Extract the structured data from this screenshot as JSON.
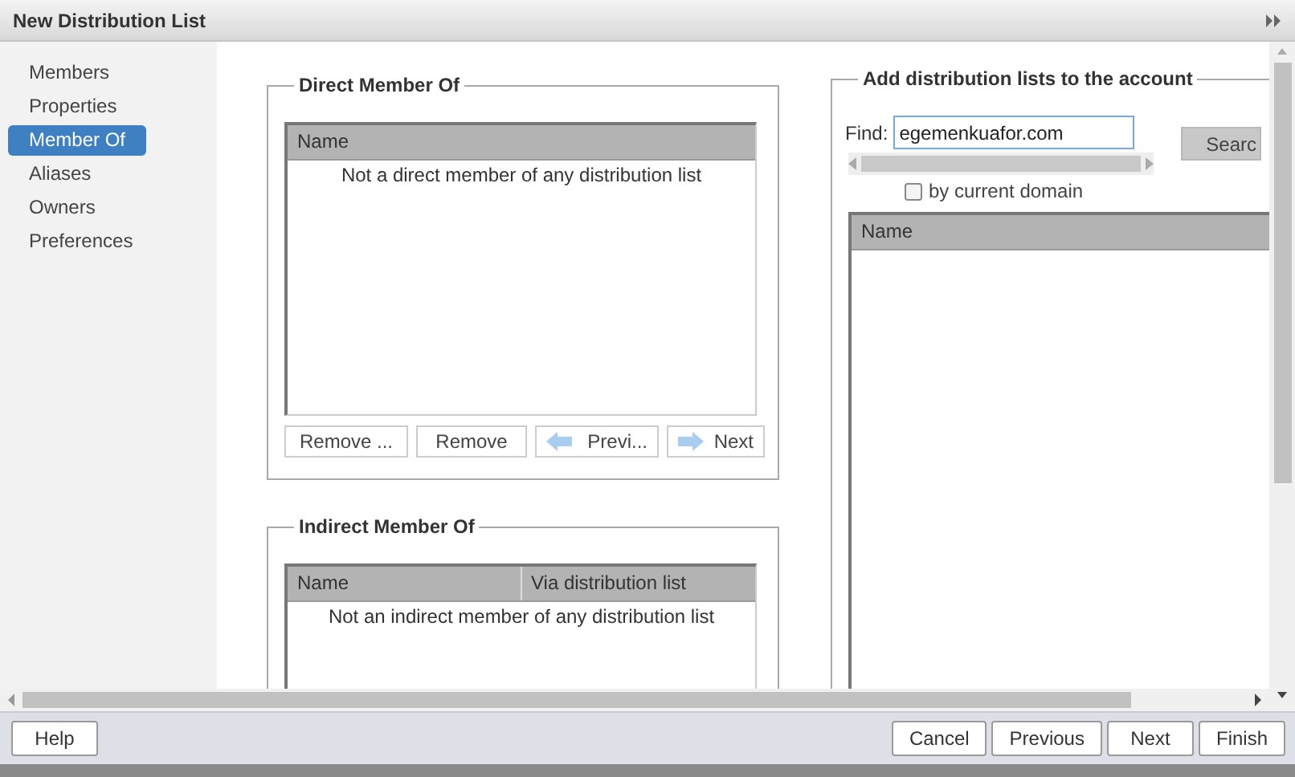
{
  "window": {
    "title": "New Distribution List"
  },
  "sidebar": {
    "items": [
      {
        "label": "Members",
        "selected": false
      },
      {
        "label": "Properties",
        "selected": false
      },
      {
        "label": "Member Of",
        "selected": true
      },
      {
        "label": "Aliases",
        "selected": false
      },
      {
        "label": "Owners",
        "selected": false
      },
      {
        "label": "Preferences",
        "selected": false
      }
    ]
  },
  "direct_member_of": {
    "title": "Direct Member Of",
    "columns": [
      "Name"
    ],
    "empty_text": "Not a direct member of any distribution list",
    "buttons": [
      {
        "label": "Remove ...",
        "kind": "plain"
      },
      {
        "label": "Remove",
        "kind": "plain"
      },
      {
        "label": "Previ...",
        "kind": "prev"
      },
      {
        "label": "Next",
        "kind": "next"
      }
    ]
  },
  "indirect_member_of": {
    "title": "Indirect Member Of",
    "columns": [
      "Name",
      "Via distribution list"
    ],
    "empty_text": "Not an indirect member of any distribution list"
  },
  "add_lists": {
    "title": "Add distribution lists to the account",
    "find_label": "Find:",
    "find_value": "egemenkuafor.com",
    "search_button": "Searc",
    "by_current_domain": {
      "label": "by current domain",
      "checked": false
    },
    "columns": [
      "Name"
    ]
  },
  "footer": {
    "help": "Help",
    "buttons": [
      "Cancel",
      "Previous",
      "Next",
      "Finish"
    ]
  }
}
